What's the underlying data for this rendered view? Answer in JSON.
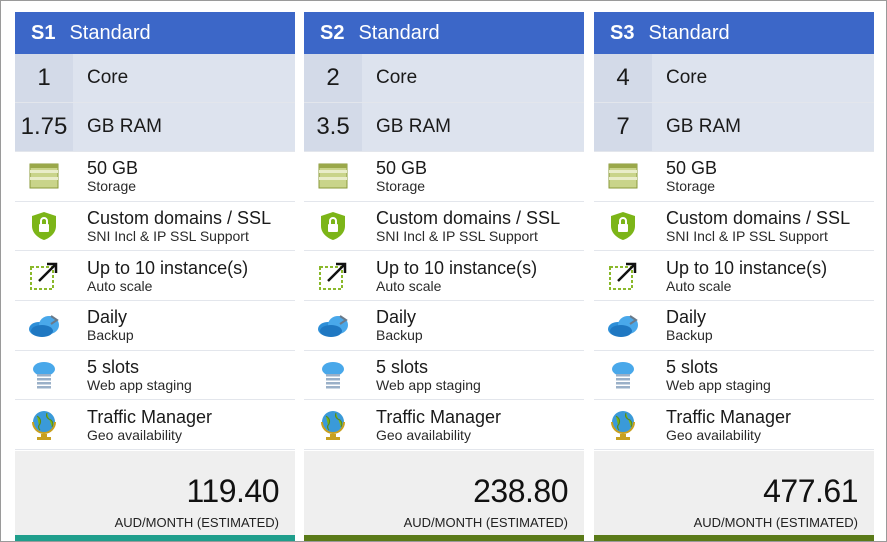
{
  "colors": {
    "header_bg": "#3c67c8",
    "footer_accent_1": "#1f9e8c",
    "footer_accent_2": "#5a7a18",
    "footer_accent_3": "#5a7a18"
  },
  "tiers": [
    {
      "code": "S1",
      "name": "Standard",
      "cores": "1",
      "cores_label": "Core",
      "ram": "1.75",
      "ram_label": "GB RAM",
      "features": [
        {
          "icon": "storage-icon",
          "title": "50 GB",
          "subtitle": "Storage"
        },
        {
          "icon": "ssl-shield-icon",
          "title": "Custom domains / SSL",
          "subtitle": "SNI Incl & IP SSL Support"
        },
        {
          "icon": "autoscale-icon",
          "title": "Up to 10 instance(s)",
          "subtitle": "Auto scale"
        },
        {
          "icon": "backup-cloud-icon",
          "title": "Daily",
          "subtitle": "Backup"
        },
        {
          "icon": "staging-slots-icon",
          "title": "5 slots",
          "subtitle": "Web app staging"
        },
        {
          "icon": "globe-icon",
          "title": "Traffic Manager",
          "subtitle": "Geo availability"
        }
      ],
      "price": "119.40",
      "price_unit": "AUD/MONTH (ESTIMATED)"
    },
    {
      "code": "S2",
      "name": "Standard",
      "cores": "2",
      "cores_label": "Core",
      "ram": "3.5",
      "ram_label": "GB RAM",
      "features": [
        {
          "icon": "storage-icon",
          "title": "50 GB",
          "subtitle": "Storage"
        },
        {
          "icon": "ssl-shield-icon",
          "title": "Custom domains / SSL",
          "subtitle": "SNI Incl & IP SSL Support"
        },
        {
          "icon": "autoscale-icon",
          "title": "Up to 10 instance(s)",
          "subtitle": "Auto scale"
        },
        {
          "icon": "backup-cloud-icon",
          "title": "Daily",
          "subtitle": "Backup"
        },
        {
          "icon": "staging-slots-icon",
          "title": "5 slots",
          "subtitle": "Web app staging"
        },
        {
          "icon": "globe-icon",
          "title": "Traffic Manager",
          "subtitle": "Geo availability"
        }
      ],
      "price": "238.80",
      "price_unit": "AUD/MONTH (ESTIMATED)"
    },
    {
      "code": "S3",
      "name": "Standard",
      "cores": "4",
      "cores_label": "Core",
      "ram": "7",
      "ram_label": "GB RAM",
      "features": [
        {
          "icon": "storage-icon",
          "title": "50 GB",
          "subtitle": "Storage"
        },
        {
          "icon": "ssl-shield-icon",
          "title": "Custom domains / SSL",
          "subtitle": "SNI Incl & IP SSL Support"
        },
        {
          "icon": "autoscale-icon",
          "title": "Up to 10 instance(s)",
          "subtitle": "Auto scale"
        },
        {
          "icon": "backup-cloud-icon",
          "title": "Daily",
          "subtitle": "Backup"
        },
        {
          "icon": "staging-slots-icon",
          "title": "5 slots",
          "subtitle": "Web app staging"
        },
        {
          "icon": "globe-icon",
          "title": "Traffic Manager",
          "subtitle": "Geo availability"
        }
      ],
      "price": "477.61",
      "price_unit": "AUD/MONTH (ESTIMATED)"
    }
  ]
}
